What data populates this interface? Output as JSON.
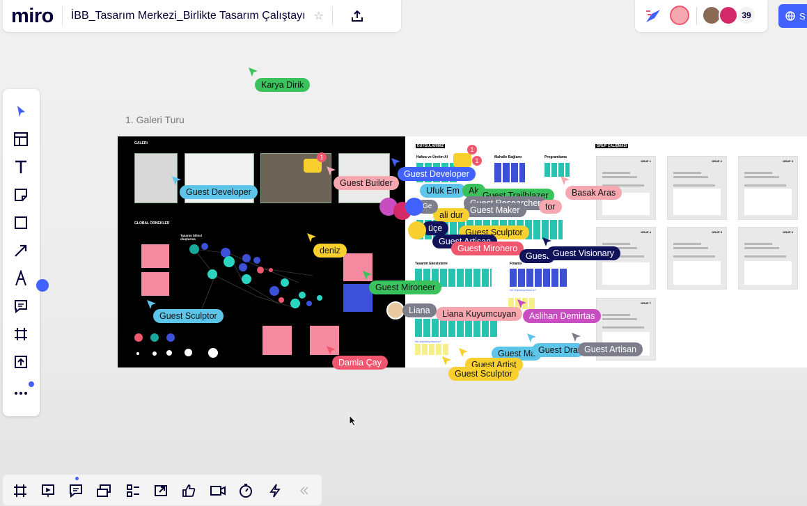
{
  "app": {
    "logo": "miro",
    "board_title": "İBB_Tasarım Merkezi_Birlikte Tasarım Çalıştayı"
  },
  "header": {
    "collaborator_count": "39",
    "share_label": "S"
  },
  "frame": {
    "label": "1. Galeri Turu"
  },
  "black_board": {
    "section_1": "GALERI",
    "section_2": "GLOBAL ÖRNEKLER",
    "chart_title": "Tasarım bilinci oluşturma"
  },
  "white_board": {
    "section_title": "DUYGULARIMIZ",
    "col_1": "Hafıza ve Üretim Al",
    "col_2": "Mahalle Bağlamı",
    "col_3": "Programlama",
    "row_2": "Tasarım Ekosistemi",
    "row_2b": "Finansı",
    "group_title": "GRUP ÇALIŞMASI",
    "cards": [
      "GRUP 1",
      "GRUP 2",
      "GRUP 3",
      "GRUP 4",
      "GRUP 5",
      "GRUP 6",
      "GRUP 7"
    ],
    "note": "Ne düşünüyorsunuz?"
  },
  "badges": {
    "comment_1": "1",
    "comment_2": "1",
    "comment_3": "1"
  },
  "cursors": [
    {
      "name": "Karya Dirik"
    },
    {
      "name": "Guest Developer"
    },
    {
      "name": "Guest Builder"
    },
    {
      "name": "Guest Developer"
    },
    {
      "name": "Ufuk Em"
    },
    {
      "name": "Ak"
    },
    {
      "name": "Guest Trailblazer"
    },
    {
      "name": "Basak Aras"
    },
    {
      "name": "Guest Researcher"
    },
    {
      "name": "Guest Maker"
    },
    {
      "name": "tor"
    },
    {
      "name": "ali dur"
    },
    {
      "name": "deniz"
    },
    {
      "name": "Guest Sculptor"
    },
    {
      "name": "Guest Artisan"
    },
    {
      "name": "Guest Mirohero"
    },
    {
      "name": "Guest Visionary"
    },
    {
      "name": "Guest"
    },
    {
      "name": "Guest Mironeer"
    },
    {
      "name": "Liana"
    },
    {
      "name": "Liana Kuyumcuyan"
    },
    {
      "name": "Aslihan Demirtas"
    },
    {
      "name": "Guest Sculptor"
    },
    {
      "name": "Guest Ma"
    },
    {
      "name": "Guest Dra"
    },
    {
      "name": "Guest Artisan"
    },
    {
      "name": "Guest Artist"
    },
    {
      "name": "Guest Sculptor"
    },
    {
      "name": "Damla Çay"
    },
    {
      "name": "üçe"
    },
    {
      "name": "Ge"
    }
  ],
  "colors": {
    "accent": "#4262ff",
    "brand_navy": "#050038"
  }
}
